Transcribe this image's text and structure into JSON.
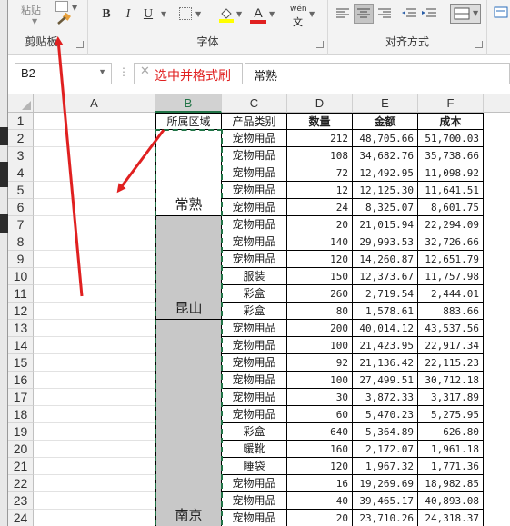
{
  "ribbon": {
    "clipboard": {
      "paste_label": "粘贴",
      "group_label": "剪贴板"
    },
    "font": {
      "bold": "B",
      "italic": "I",
      "underline": "U",
      "font_color_glyph": "A",
      "phonetic_glyph": "wén",
      "group_label": "字体"
    },
    "alignment": {
      "group_label": "对齐方式"
    }
  },
  "formula_bar": {
    "name_box": "B2",
    "value": "常熟",
    "annotation": "选中并格式刷"
  },
  "columns": [
    "A",
    "B",
    "C",
    "D",
    "E",
    "F"
  ],
  "header_row": {
    "B": "所属区域",
    "C": "产品类别",
    "D": "数量",
    "E": "金额",
    "F": "成本"
  },
  "merged_regions": [
    {
      "label": "常熟",
      "rows": [
        2,
        6
      ]
    },
    {
      "label": "昆山",
      "rows": [
        7,
        12
      ]
    },
    {
      "label": "南京",
      "rows": [
        13,
        24
      ]
    }
  ],
  "rows": [
    {
      "n": 2,
      "c": "宠物用品",
      "d": "212",
      "e": "48,705.66",
      "f": "51,700.03"
    },
    {
      "n": 3,
      "c": "宠物用品",
      "d": "108",
      "e": "34,682.76",
      "f": "35,738.66"
    },
    {
      "n": 4,
      "c": "宠物用品",
      "d": "72",
      "e": "12,492.95",
      "f": "11,098.92"
    },
    {
      "n": 5,
      "c": "宠物用品",
      "d": "12",
      "e": "12,125.30",
      "f": "11,641.51"
    },
    {
      "n": 6,
      "c": "宠物用品",
      "d": "24",
      "e": "8,325.07",
      "f": "8,601.75"
    },
    {
      "n": 7,
      "c": "宠物用品",
      "d": "20",
      "e": "21,015.94",
      "f": "22,294.09"
    },
    {
      "n": 8,
      "c": "宠物用品",
      "d": "140",
      "e": "29,993.53",
      "f": "32,726.66"
    },
    {
      "n": 9,
      "c": "宠物用品",
      "d": "120",
      "e": "14,260.87",
      "f": "12,651.79"
    },
    {
      "n": 10,
      "c": "服装",
      "d": "150",
      "e": "12,373.67",
      "f": "11,757.98"
    },
    {
      "n": 11,
      "c": "彩盒",
      "d": "260",
      "e": "2,719.54",
      "f": "2,444.01"
    },
    {
      "n": 12,
      "c": "彩盒",
      "d": "80",
      "e": "1,578.61",
      "f": "883.66"
    },
    {
      "n": 13,
      "c": "宠物用品",
      "d": "200",
      "e": "40,014.12",
      "f": "43,537.56"
    },
    {
      "n": 14,
      "c": "宠物用品",
      "d": "100",
      "e": "21,423.95",
      "f": "22,917.34"
    },
    {
      "n": 15,
      "c": "宠物用品",
      "d": "92",
      "e": "21,136.42",
      "f": "22,115.23"
    },
    {
      "n": 16,
      "c": "宠物用品",
      "d": "100",
      "e": "27,499.51",
      "f": "30,712.18"
    },
    {
      "n": 17,
      "c": "宠物用品",
      "d": "30",
      "e": "3,872.33",
      "f": "3,317.89"
    },
    {
      "n": 18,
      "c": "宠物用品",
      "d": "60",
      "e": "5,470.23",
      "f": "5,275.95"
    },
    {
      "n": 19,
      "c": "彩盒",
      "d": "640",
      "e": "5,364.89",
      "f": "626.80"
    },
    {
      "n": 20,
      "c": "暖靴",
      "d": "160",
      "e": "2,172.07",
      "f": "1,961.18"
    },
    {
      "n": 21,
      "c": "睡袋",
      "d": "120",
      "e": "1,967.32",
      "f": "1,771.36"
    },
    {
      "n": 22,
      "c": "宠物用品",
      "d": "16",
      "e": "19,269.69",
      "f": "18,982.85"
    },
    {
      "n": 23,
      "c": "宠物用品",
      "d": "40",
      "e": "39,465.17",
      "f": "40,893.08"
    },
    {
      "n": 24,
      "c": "宠物用品",
      "d": "20",
      "e": "23,710.26",
      "f": "24,318.37"
    }
  ],
  "colors": {
    "accent": "#217346",
    "annotation": "#e02020",
    "merged_fill": "#c8c8c8"
  }
}
